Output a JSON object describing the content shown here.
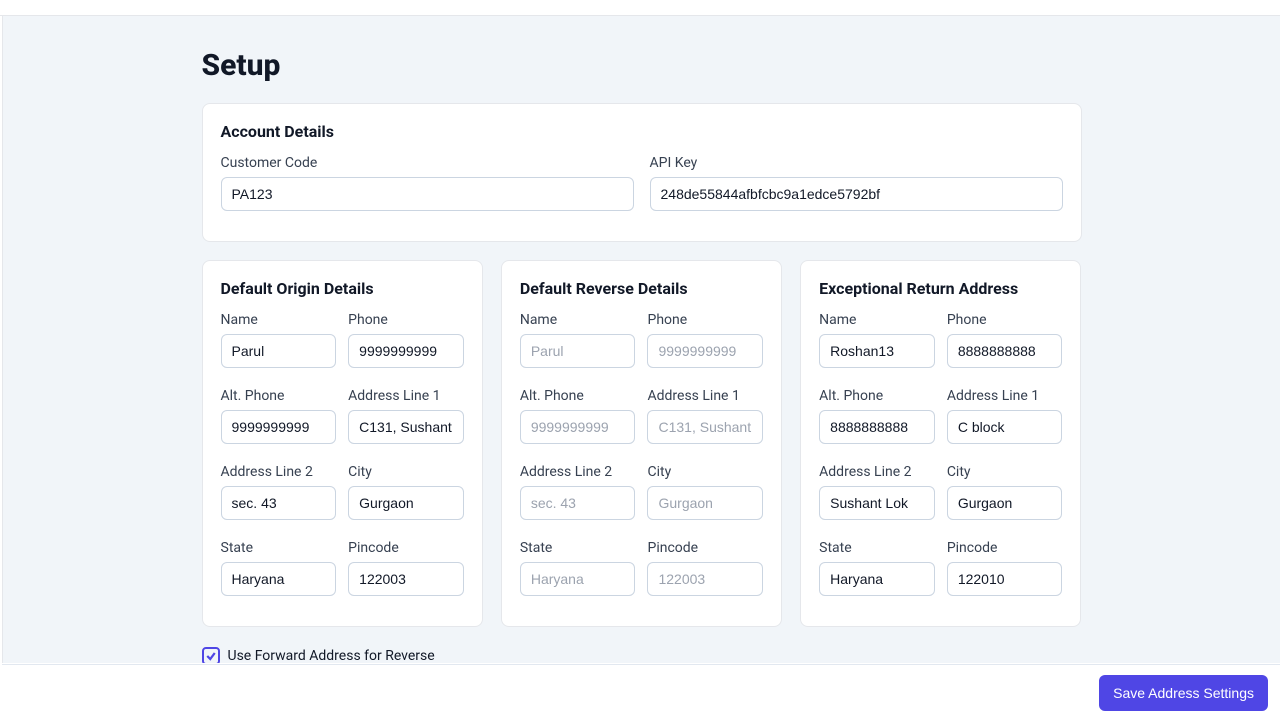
{
  "page": {
    "title": "Setup"
  },
  "account": {
    "title": "Account Details",
    "customer_code": {
      "label": "Customer Code",
      "value": "PA123"
    },
    "api_key": {
      "label": "API Key",
      "value": "248de55844afbfcbc9a1edce5792bf"
    }
  },
  "origin": {
    "title": "Default Origin Details",
    "name": {
      "label": "Name",
      "value": "Parul"
    },
    "phone": {
      "label": "Phone",
      "value": "9999999999"
    },
    "alt_phone": {
      "label": "Alt. Phone",
      "value": "9999999999"
    },
    "addr1": {
      "label": "Address Line 1",
      "value": "C131, Sushant"
    },
    "addr2": {
      "label": "Address Line 2",
      "value": "sec. 43"
    },
    "city": {
      "label": "City",
      "value": "Gurgaon"
    },
    "state": {
      "label": "State",
      "value": "Haryana"
    },
    "pincode": {
      "label": "Pincode",
      "value": "122003"
    }
  },
  "reverse": {
    "title": "Default Reverse Details",
    "name": {
      "label": "Name",
      "value": "Parul"
    },
    "phone": {
      "label": "Phone",
      "value": "9999999999"
    },
    "alt_phone": {
      "label": "Alt. Phone",
      "value": "9999999999"
    },
    "addr1": {
      "label": "Address Line 1",
      "value": "C131, Sushant"
    },
    "addr2": {
      "label": "Address Line 2",
      "value": "sec. 43"
    },
    "city": {
      "label": "City",
      "value": "Gurgaon"
    },
    "state": {
      "label": "State",
      "value": "Haryana"
    },
    "pincode": {
      "label": "Pincode",
      "value": "122003"
    }
  },
  "exceptional": {
    "title": "Exceptional Return Address",
    "name": {
      "label": "Name",
      "value": "Roshan13"
    },
    "phone": {
      "label": "Phone",
      "value": "8888888888"
    },
    "alt_phone": {
      "label": "Alt. Phone",
      "value": "8888888888"
    },
    "addr1": {
      "label": "Address Line 1",
      "value": "C block"
    },
    "addr2": {
      "label": "Address Line 2",
      "value": "Sushant Lok"
    },
    "city": {
      "label": "City",
      "value": "Gurgaon"
    },
    "state": {
      "label": "State",
      "value": "Haryana"
    },
    "pincode": {
      "label": "Pincode",
      "value": "122010"
    }
  },
  "checkbox": {
    "label": "Use Forward Address for Reverse",
    "checked": true
  },
  "footer": {
    "save_label": "Save Address Settings"
  }
}
